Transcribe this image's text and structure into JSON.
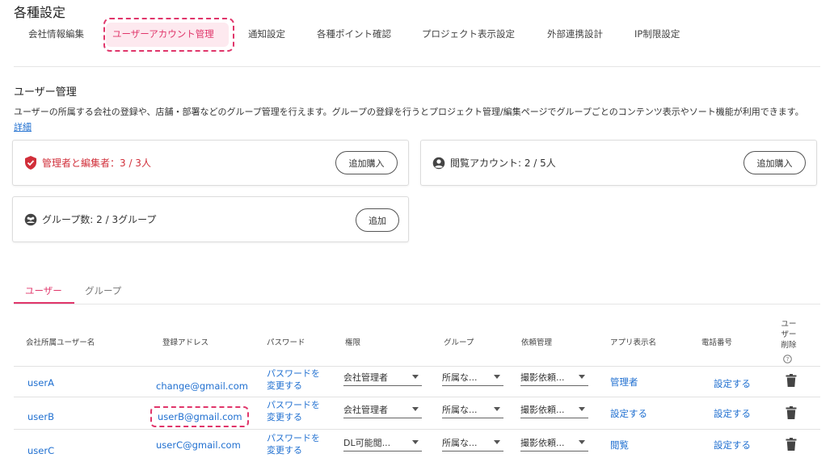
{
  "page": {
    "title": "各種設定"
  },
  "tabs": [
    {
      "label": "会社情報編集"
    },
    {
      "label": "ユーザーアカウント管理"
    },
    {
      "label": "通知設定"
    },
    {
      "label": "各種ポイント確認"
    },
    {
      "label": "プロジェクト表示設定"
    },
    {
      "label": "外部連携設計"
    },
    {
      "label": "IP制限設定"
    }
  ],
  "user_section": {
    "title": "ユーザー管理",
    "description": "ユーザーの所属する会社の登録や、店舗・部署などのグループ管理を行えます。グループの登録を行うとプロジェクト管理/編集ページでグループごとのコンテンツ表示やソート機能が利用できます。",
    "detail_link": "詳細"
  },
  "cards": {
    "admin": {
      "label": "管理者と編集者：3 / 3人",
      "button": "追加購入",
      "icon": "shield-check-icon"
    },
    "viewer": {
      "label": "閲覧アカウント: 2 / 5人",
      "button": "追加購入",
      "icon": "account-circle-icon"
    },
    "group": {
      "label": "グループ数: 2 / 3グループ",
      "button": "追加",
      "icon": "group-icon"
    }
  },
  "sub_tabs": [
    {
      "label": "ユーザー"
    },
    {
      "label": "グループ"
    }
  ],
  "table": {
    "headers": {
      "name": "会社所属ユーザー名",
      "email": "登録アドレス",
      "password": "パスワード",
      "role": "権限",
      "group": "グループ",
      "request": "依頼管理",
      "app_name": "アプリ表示名",
      "phone": "電話番号",
      "delete": "ユー\nザー\n削除"
    },
    "rows": [
      {
        "name": "userA",
        "email": "change@gmail.com",
        "password": "パスワードを\n変更する",
        "role": "会社管理者",
        "group": "所属な...",
        "request": "撮影依頼...",
        "app_name": "管理者",
        "phone": "設定する"
      },
      {
        "name": "userB",
        "email": "userB@gmail.com",
        "password": "パスワードを\n変更する",
        "role": "会社管理者",
        "group": "所属な...",
        "request": "撮影依頼...",
        "app_name": "設定する",
        "phone": "設定する"
      },
      {
        "name": "userC",
        "email": "userC@gmail.com",
        "password": "パスワードを\n変更する",
        "role": "DL可能閲...",
        "group": "所属な...",
        "request": "撮影依頼...",
        "app_name": "閲覧",
        "phone": "設定する"
      }
    ]
  },
  "colors": {
    "accent": "#e0356a",
    "link": "#1f6fd0",
    "alert": "#d12f3a"
  }
}
